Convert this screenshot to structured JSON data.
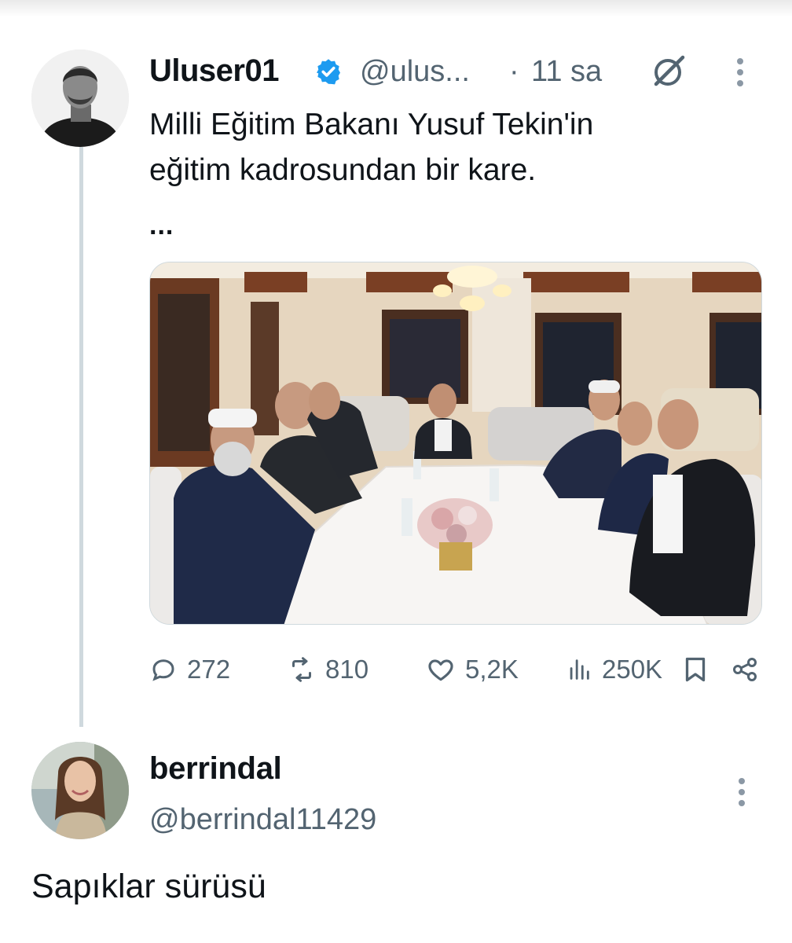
{
  "tweet": {
    "display_name": "Uluser01",
    "handle": "@ulus...",
    "separator": "·",
    "time": "11 sa",
    "text": "Milli Eğitim Bakanı Yusuf Tekin'in\neğitim kadrosundan bir kare.",
    "truncation": "...",
    "verified": true,
    "verified_color": "#1d9bf0",
    "avatar_icon": "user-avatar-icon",
    "media_icon": "photo-meeting-table",
    "stats": {
      "replies": "272",
      "retweets": "810",
      "likes": "5,2K",
      "views": "250K"
    }
  },
  "reply": {
    "display_name": "berrindal",
    "handle": "@berrindal11429",
    "text": "Sapıklar sürüsü",
    "avatar_icon": "user-avatar-icon"
  },
  "icons": {
    "reply": "reply-bubble-icon",
    "retweet": "retweet-icon",
    "like": "heart-icon",
    "views": "views-chart-icon",
    "bookmark": "bookmark-icon",
    "share": "share-icon",
    "grok": "grok-icon",
    "more": "more-vertical-icon"
  },
  "colors": {
    "text_primary": "#0f1419",
    "text_secondary": "#536471",
    "thread_line": "#cfd9de"
  }
}
